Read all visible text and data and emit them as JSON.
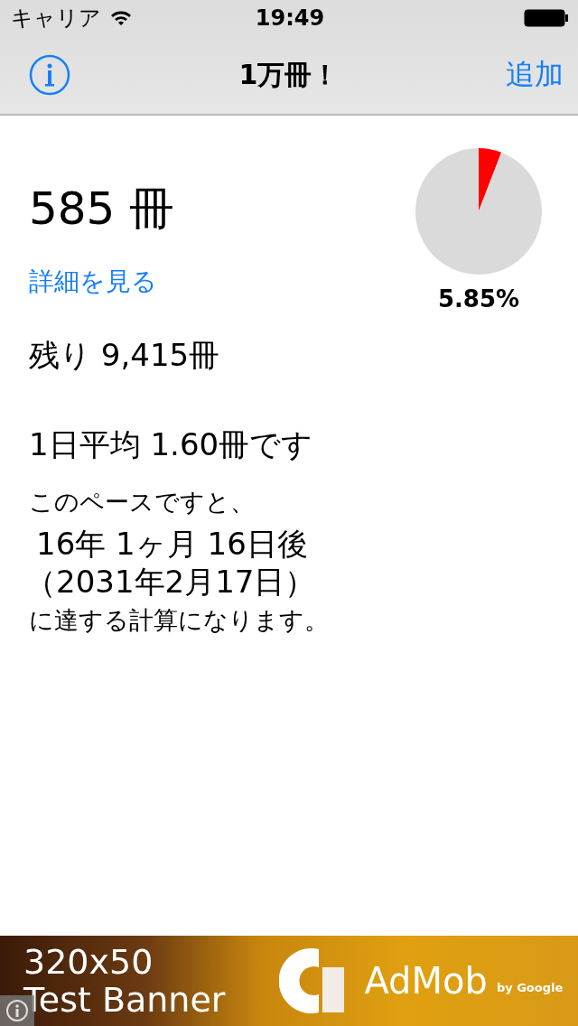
{
  "status_bar": {
    "carrier": "キャリア",
    "time": "19:49"
  },
  "nav_bar": {
    "title": "1万冊！",
    "right_button": "追加"
  },
  "summary": {
    "count": "585 冊",
    "details_link": "詳細を見る",
    "progress": {
      "chart_data": {
        "type": "pie",
        "values": [
          5.85,
          94.15
        ]
      },
      "reading": "5.85%"
    }
  },
  "remaining": "残り 9,415冊",
  "average": "1日平均 1.60冊です",
  "forecast": {
    "intro": "このペースですと、",
    "duration": "16年 1ヶ月 16日後",
    "date": "（2031年2月17日）",
    "outro": "に達する計算になります。"
  },
  "ad_banner": {
    "size": "320x50",
    "label": "Test Banner",
    "brand": "AdMob",
    "byline": "by Google"
  }
}
